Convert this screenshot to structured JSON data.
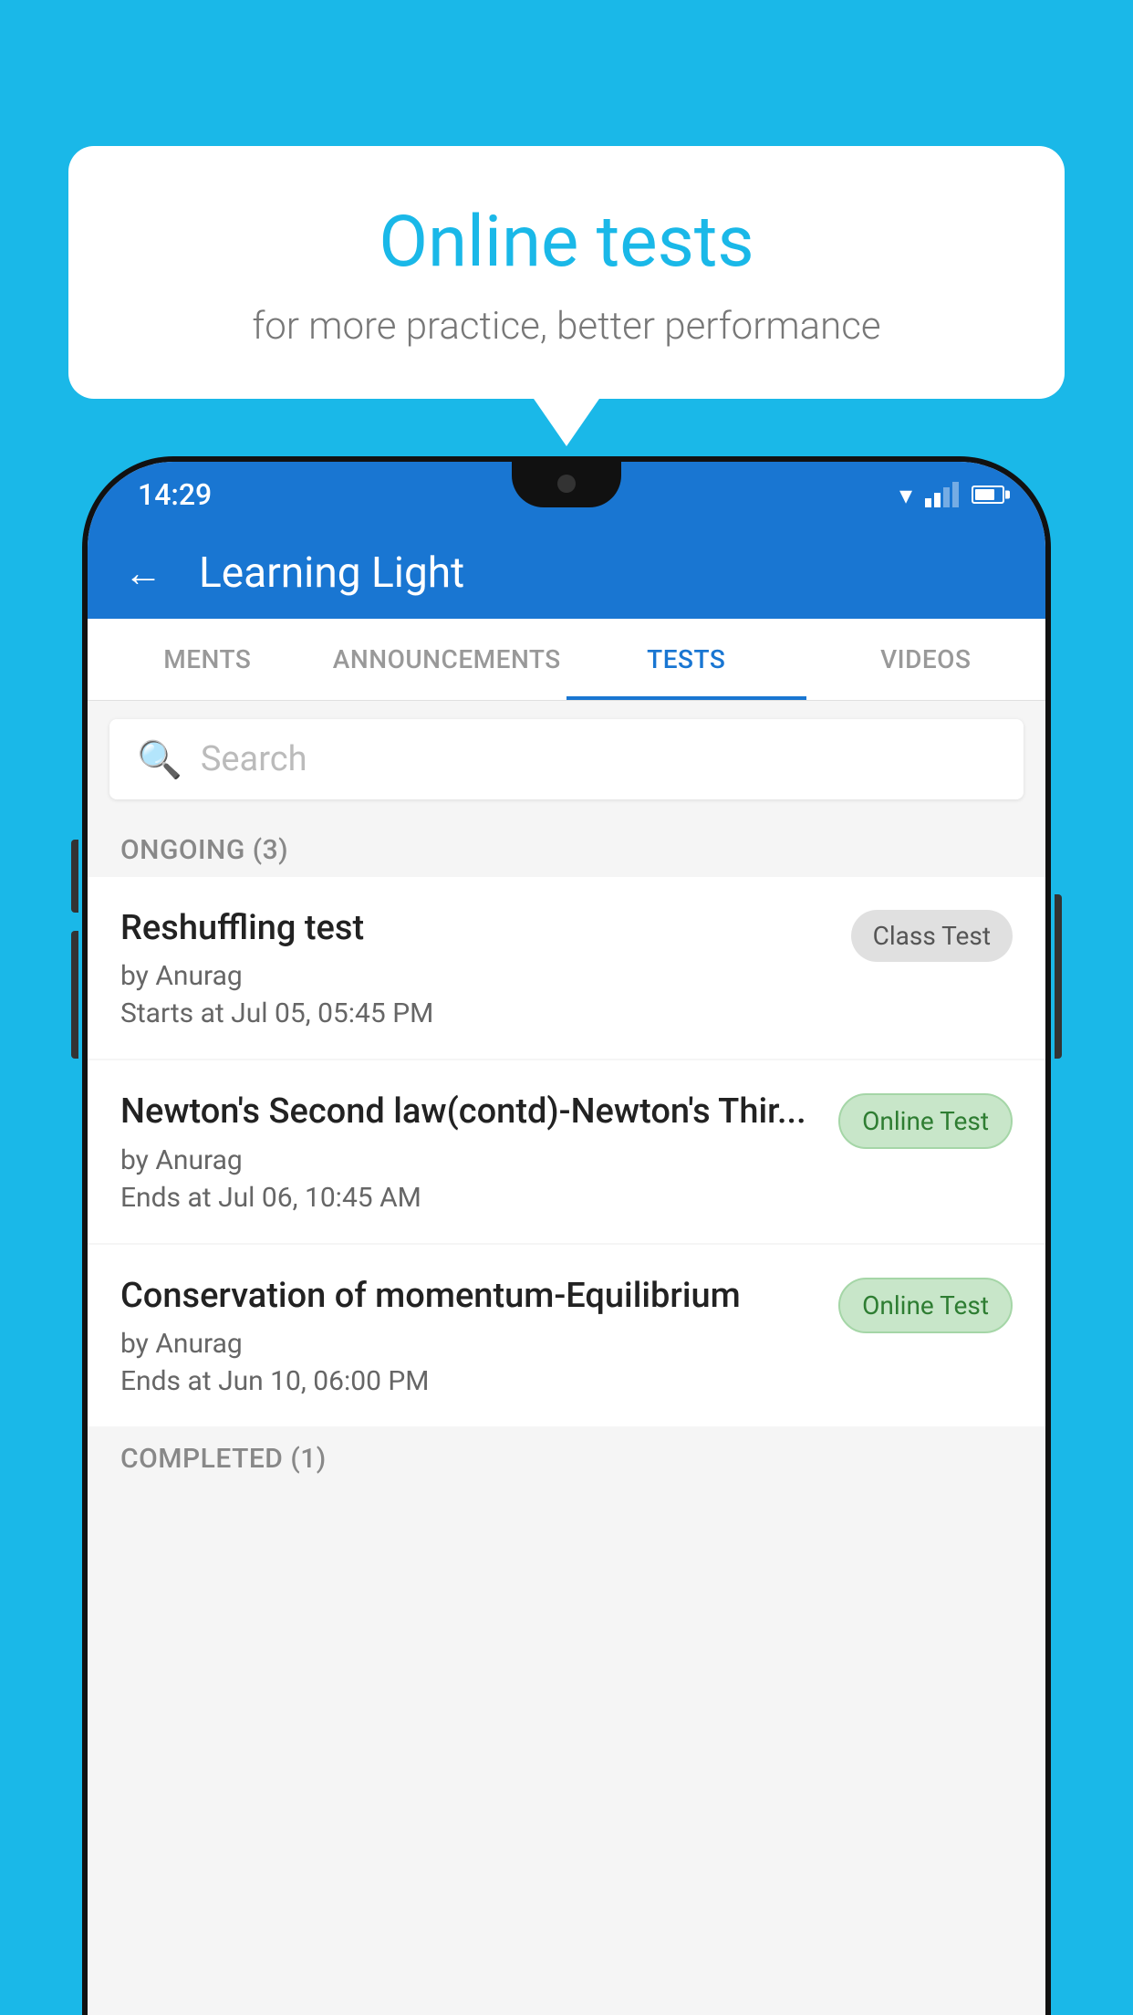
{
  "background_color": "#1ab8e8",
  "speech_bubble": {
    "title": "Online tests",
    "subtitle": "for more practice, better performance"
  },
  "status_bar": {
    "time": "14:29"
  },
  "header": {
    "title": "Learning Light",
    "back_label": "←"
  },
  "tabs": [
    {
      "id": "ments",
      "label": "MENTS",
      "active": false
    },
    {
      "id": "announcements",
      "label": "ANNOUNCEMENTS",
      "active": false
    },
    {
      "id": "tests",
      "label": "TESTS",
      "active": true
    },
    {
      "id": "videos",
      "label": "VIDEOS",
      "active": false
    }
  ],
  "search": {
    "placeholder": "Search"
  },
  "ongoing_section": {
    "label": "ONGOING (3)"
  },
  "tests": [
    {
      "id": 1,
      "name": "Reshuffling test",
      "author": "by Anurag",
      "time_label": "Starts at",
      "time": "Jul 05, 05:45 PM",
      "badge": "Class Test",
      "badge_type": "class"
    },
    {
      "id": 2,
      "name": "Newton's Second law(contd)-Newton's Thir...",
      "author": "by Anurag",
      "time_label": "Ends at",
      "time": "Jul 06, 10:45 AM",
      "badge": "Online Test",
      "badge_type": "online"
    },
    {
      "id": 3,
      "name": "Conservation of momentum-Equilibrium",
      "author": "by Anurag",
      "time_label": "Ends at",
      "time": "Jun 10, 06:00 PM",
      "badge": "Online Test",
      "badge_type": "online"
    }
  ],
  "completed_section": {
    "label": "COMPLETED (1)"
  }
}
